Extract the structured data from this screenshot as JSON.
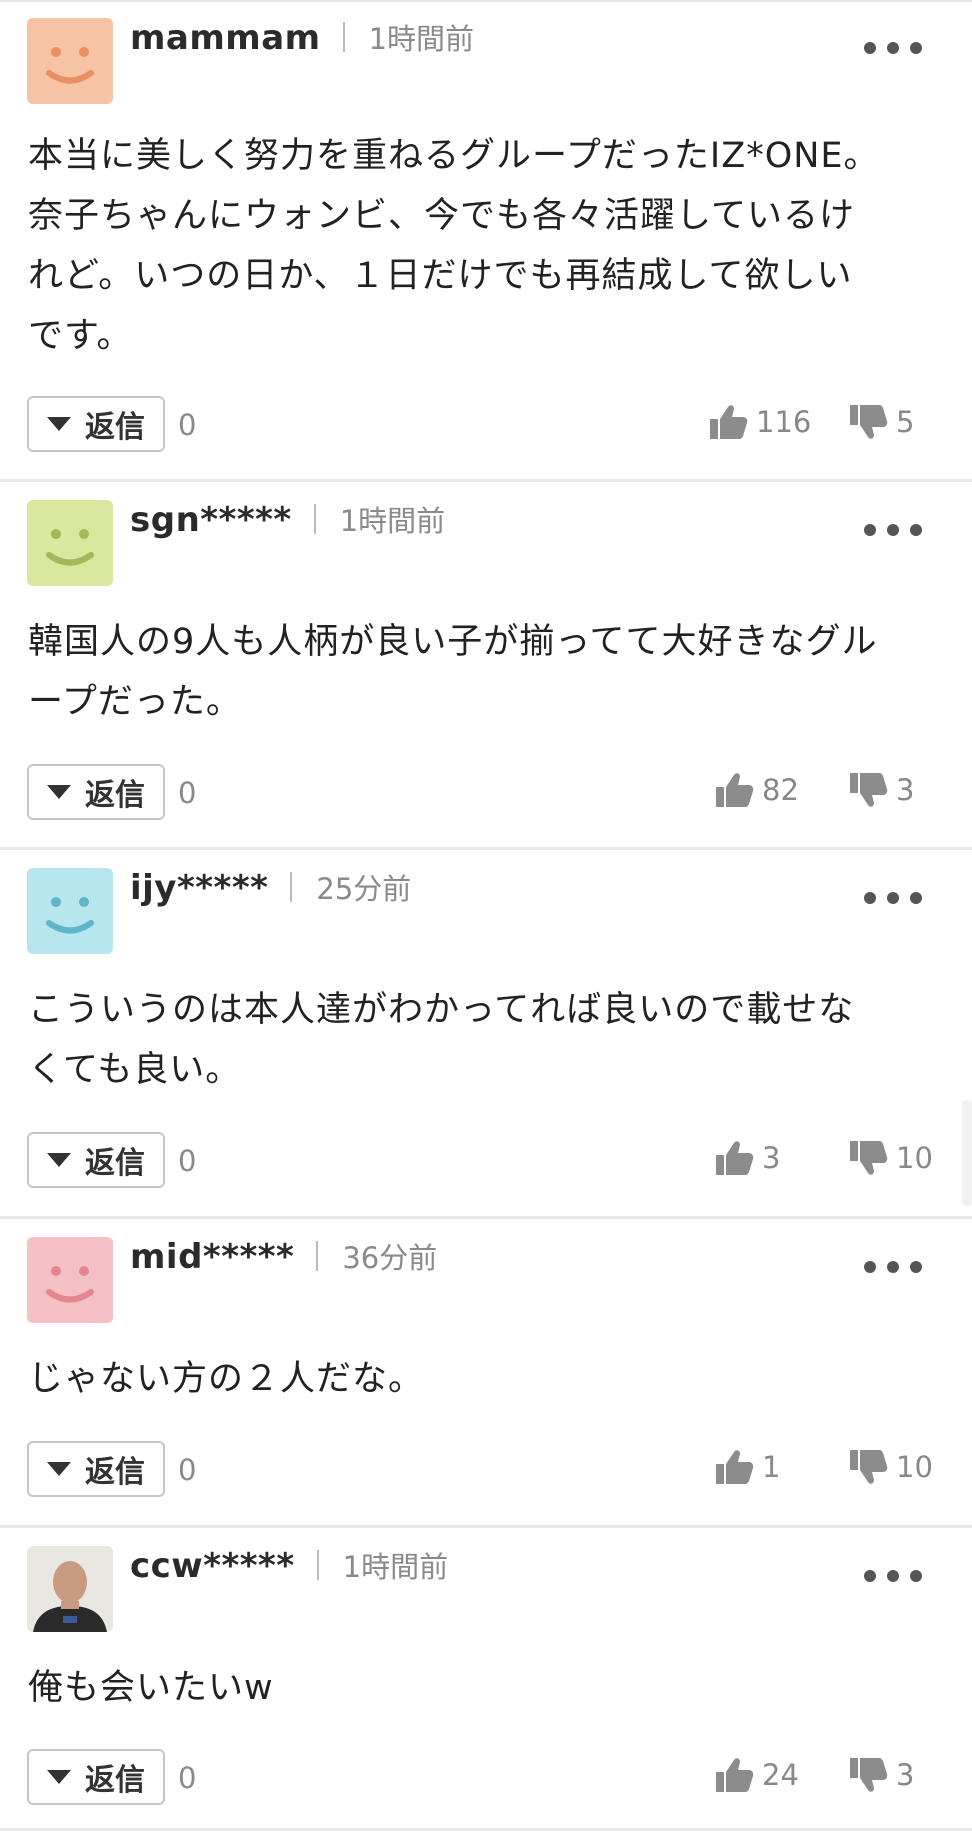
{
  "comments": [
    {
      "username": "mammam",
      "time": "1時間前",
      "avatar": {
        "type": "smiley",
        "bg": "#f6c3a5",
        "fg": "#e8905f"
      },
      "text": "本当に美しく努力を重ねるグループだったIZ*ONE。\n奈子ちゃんにウォンビ、今でも各々活躍しているけ\nれど。いつの日か、１日だけでも再結成して欲しい\nです。",
      "reply_label": "返信",
      "reply_count": "0",
      "likes": "116",
      "dislikes": "5"
    },
    {
      "username": "sgn*****",
      "time": "1時間前",
      "avatar": {
        "type": "smiley",
        "bg": "#d9e79f",
        "fg": "#a4b85a"
      },
      "text": "韓国人の9人も人柄が良い子が揃ってて大好きなグル\nープだった。",
      "reply_label": "返信",
      "reply_count": "0",
      "likes": "82",
      "dislikes": "3"
    },
    {
      "username": "ijy*****",
      "time": "25分前",
      "avatar": {
        "type": "smiley",
        "bg": "#b7e6ee",
        "fg": "#5fb6cb"
      },
      "text": "こういうのは本人達がわかってれば良いので載せな\nくても良い。",
      "reply_label": "返信",
      "reply_count": "0",
      "likes": "3",
      "dislikes": "10"
    },
    {
      "username": "mid*****",
      "time": "36分前",
      "avatar": {
        "type": "smiley",
        "bg": "#f4c0c3",
        "fg": "#e2878d"
      },
      "text": "じゃない方の２人だな。",
      "reply_label": "返信",
      "reply_count": "0",
      "likes": "1",
      "dislikes": "10"
    },
    {
      "username": "ccw*****",
      "time": "1時間前",
      "avatar": {
        "type": "photo",
        "bg": "#e9e7e2",
        "fg": "#c89a82"
      },
      "text": "俺も会いたいw",
      "reply_label": "返信",
      "reply_count": "0",
      "likes": "24",
      "dislikes": "3"
    }
  ],
  "icons": {
    "more": "more-dots-icon",
    "reply": "triangle-down-icon",
    "like": "thumbs-up-icon",
    "dislike": "thumbs-down-icon"
  },
  "colors": {
    "icon_gray": "#8c8c8c",
    "divider": "#e8e8e8",
    "meta_text": "#8a8a8a"
  }
}
